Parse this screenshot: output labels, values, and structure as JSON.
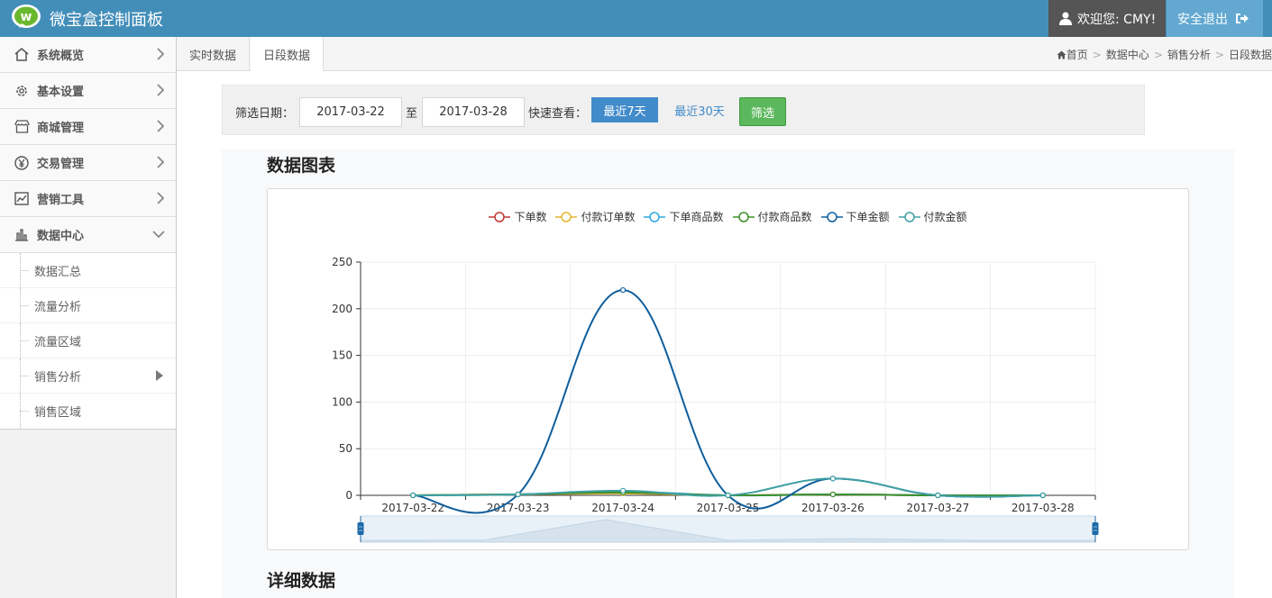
{
  "header": {
    "brand": "微宝盒控制面板",
    "welcome": "欢迎您: CMY!",
    "logout": "安全退出"
  },
  "sidebar": {
    "items": [
      {
        "label": "系统概览",
        "icon": "home-icon"
      },
      {
        "label": "基本设置",
        "icon": "gear-icon"
      },
      {
        "label": "商城管理",
        "icon": "store-icon"
      },
      {
        "label": "交易管理",
        "icon": "yen-icon"
      },
      {
        "label": "营销工具",
        "icon": "trend-chart-icon"
      },
      {
        "label": "数据中心",
        "icon": "bar-chart-icon",
        "expanded": true
      }
    ],
    "sub_items": [
      {
        "label": "数据汇总"
      },
      {
        "label": "流量分析"
      },
      {
        "label": "流量区域"
      },
      {
        "label": "销售分析",
        "active": true
      },
      {
        "label": "销售区域"
      }
    ]
  },
  "tabs": [
    {
      "label": "实时数据"
    },
    {
      "label": "日段数据",
      "active": true
    }
  ],
  "breadcrumb": [
    "首页",
    "数据中心",
    "销售分析",
    "日段数据"
  ],
  "filter": {
    "label": "筛选日期：",
    "start": "2017-03-22",
    "to": "至",
    "end": "2017-03-28",
    "quick_label": "快速查看：",
    "last7": "最近7天",
    "last30": "最近30天",
    "submit": "筛选"
  },
  "sections": {
    "chart_title": "数据图表",
    "detail_title": "详细数据"
  },
  "colors": {
    "header_bg": "#438eb9",
    "accent": "#428bca",
    "green": "#5cb85c"
  },
  "chart_data": {
    "type": "line",
    "categories": [
      "2017-03-22",
      "2017-03-23",
      "2017-03-24",
      "2017-03-25",
      "2017-03-26",
      "2017-03-27",
      "2017-03-28"
    ],
    "ylim": [
      0,
      250
    ],
    "yticks": [
      0,
      50,
      100,
      150,
      200,
      250
    ],
    "smooth": true,
    "grid": true,
    "legend_position": "top-center",
    "series": [
      {
        "name": "下单数",
        "color": "#c23531",
        "values": [
          0,
          1,
          3,
          0,
          1,
          0,
          0
        ]
      },
      {
        "name": "付款订单数",
        "color": "#e5b52f",
        "values": [
          0,
          1,
          2,
          0,
          1,
          0,
          0
        ]
      },
      {
        "name": "下单商品数",
        "color": "#2ea7e0",
        "values": [
          0,
          1,
          4,
          0,
          1,
          0,
          0
        ]
      },
      {
        "name": "付款商品数",
        "color": "#3c8f2a",
        "values": [
          0,
          1,
          3,
          0,
          1,
          0,
          0
        ]
      },
      {
        "name": "下单金额",
        "color": "#0f5e9c",
        "values": [
          0,
          1,
          220,
          0,
          18,
          0,
          0
        ]
      },
      {
        "name": "付款金额",
        "color": "#3fa0a3",
        "values": [
          0,
          1,
          5,
          0,
          18,
          0,
          0
        ]
      }
    ]
  }
}
